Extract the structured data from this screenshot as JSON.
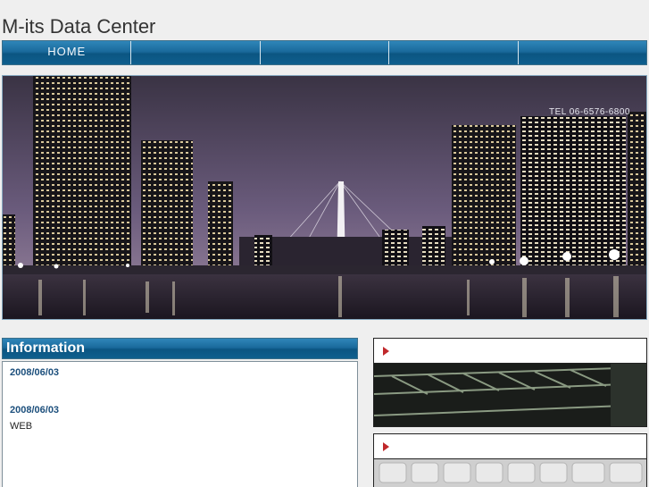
{
  "site": {
    "title": "M-its Data Center"
  },
  "nav": {
    "items": [
      "HOME",
      "",
      "",
      "",
      ""
    ]
  },
  "hero": {
    "tel": "TEL 06-6576-6800"
  },
  "information": {
    "heading": "Information",
    "items": [
      {
        "date": "2008/06/03",
        "text": ""
      },
      {
        "date": "2008/06/03",
        "text": "WEB"
      }
    ]
  },
  "side_links": [
    {
      "label": "",
      "icon": "arrow-right-icon"
    },
    {
      "label": "",
      "icon": "arrow-right-icon"
    }
  ]
}
